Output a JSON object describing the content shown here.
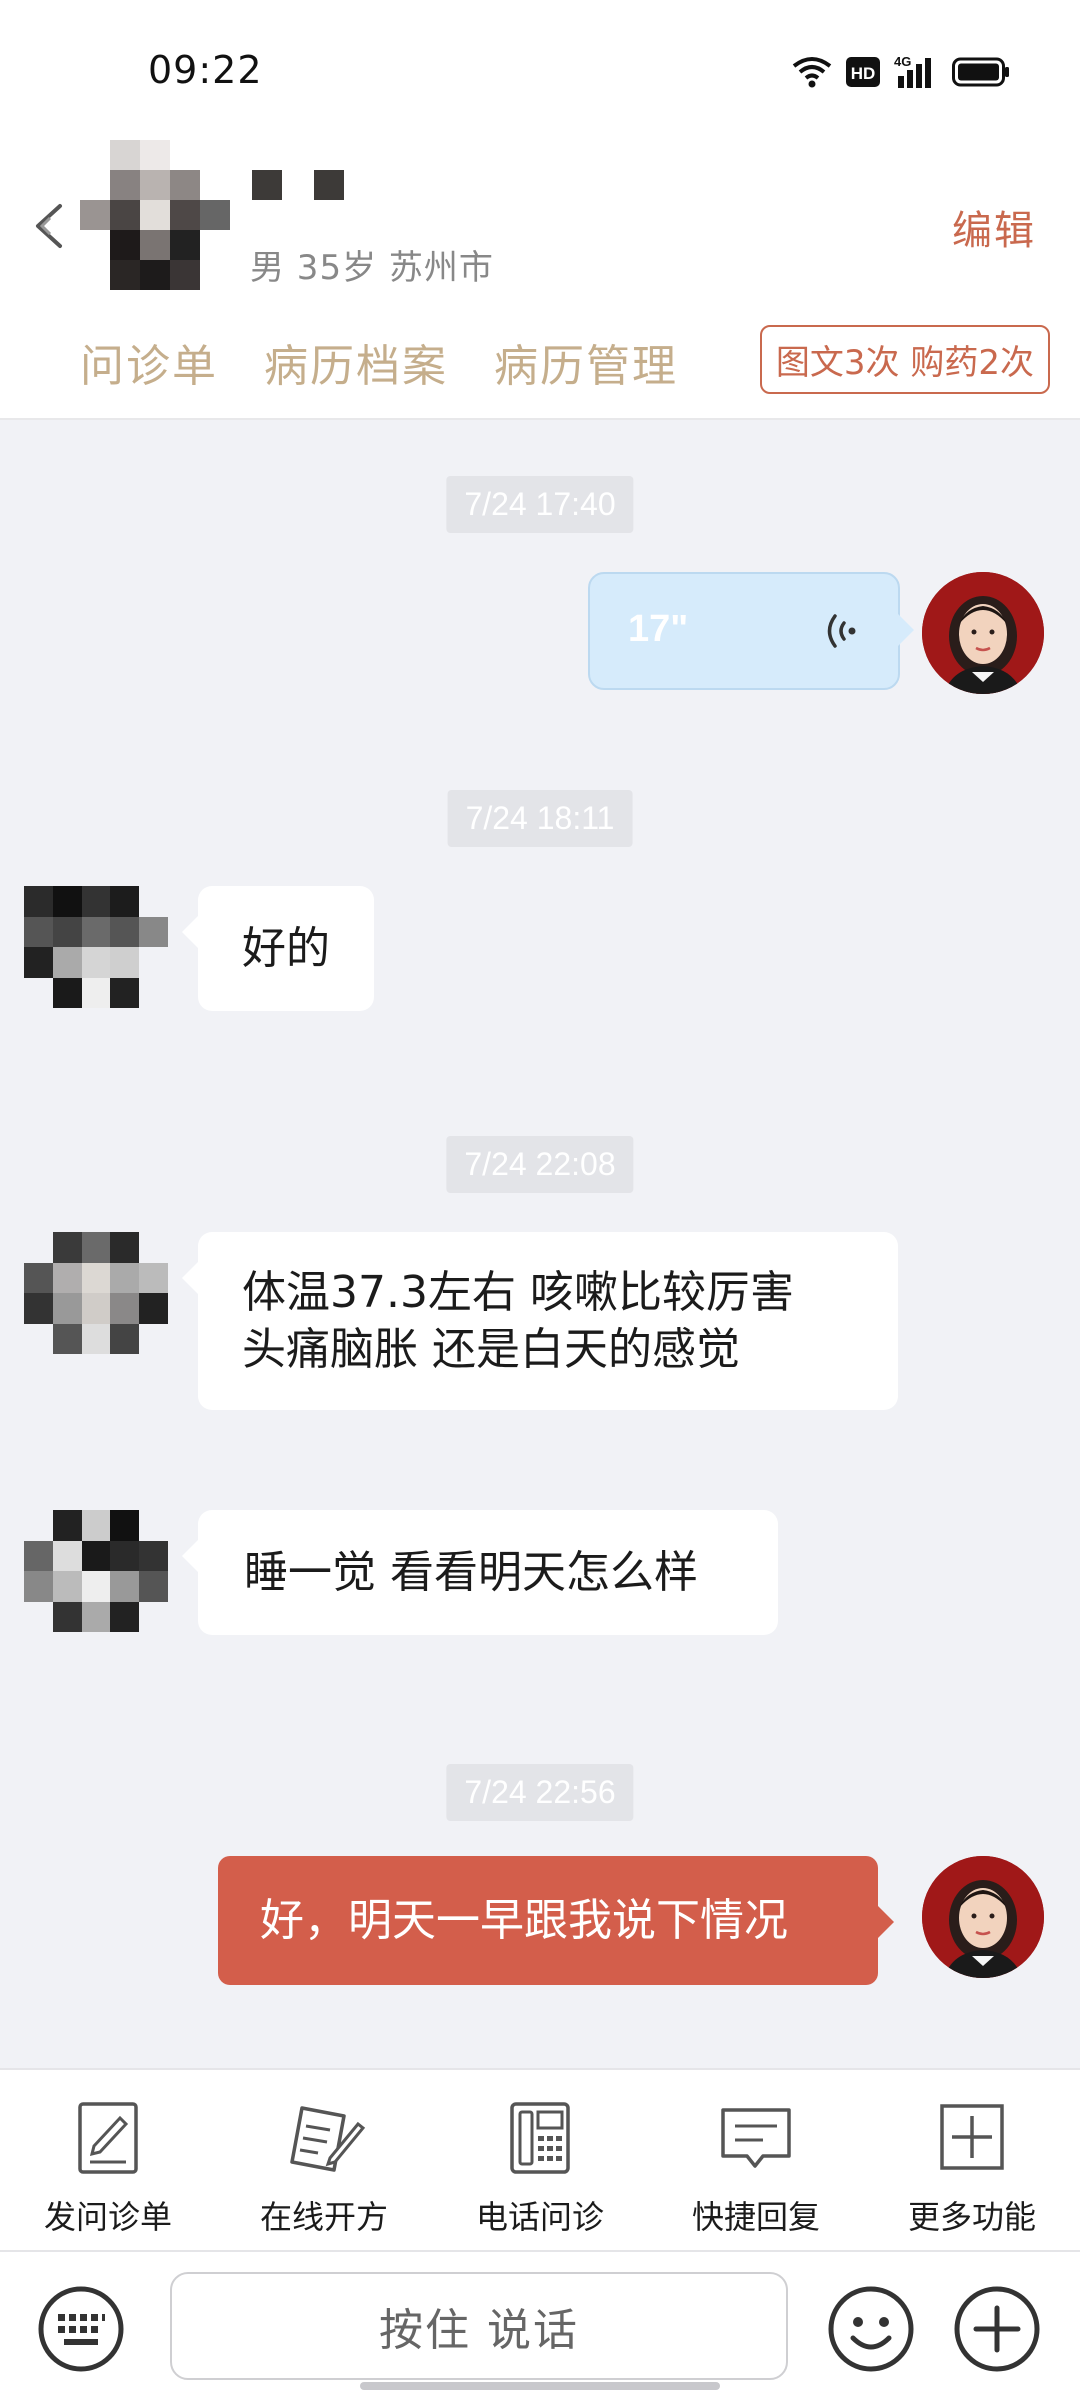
{
  "status_bar": {
    "time": "09:22",
    "icons": [
      "wifi-icon",
      "hd-icon",
      "4g-signal-icon",
      "battery-icon"
    ],
    "hd_label": "HD",
    "network_label": "4G"
  },
  "header": {
    "patient_info": "男 35岁  苏州市",
    "edit_label": "编辑",
    "tabs": [
      {
        "label": "问诊单"
      },
      {
        "label": "病历档案"
      },
      {
        "label": "病历管理"
      }
    ],
    "badge": "图文3次 购药2次"
  },
  "chat": {
    "messages": [
      {
        "timestamp": "7/24 17:40",
        "sender": "doctor",
        "type": "voice",
        "duration": "17\""
      },
      {
        "timestamp": "7/24 18:11",
        "sender": "patient",
        "type": "text",
        "text": "好的"
      },
      {
        "timestamp": "7/24 22:08",
        "sender": "patient",
        "type": "text",
        "lines": [
          "体温37.3左右  咳嗽比较厉害",
          "头痛脑胀 还是白天的感觉"
        ]
      },
      {
        "sender": "patient",
        "type": "text",
        "text": "睡一觉 看看明天怎么样"
      },
      {
        "timestamp": "7/24 22:56",
        "sender": "doctor",
        "type": "text",
        "text": "好，明天一早跟我说下情况"
      }
    ]
  },
  "toolbar": {
    "items": [
      {
        "label": "发问诊单",
        "icon": "form-icon"
      },
      {
        "label": "在线开方",
        "icon": "prescription-icon"
      },
      {
        "label": "电话问诊",
        "icon": "phone-icon"
      },
      {
        "label": "快捷回复",
        "icon": "quick-reply-icon"
      },
      {
        "label": "更多功能",
        "icon": "plus-square-icon"
      }
    ]
  },
  "input_bar": {
    "voice_label": "按住 说话"
  },
  "colors": {
    "accent": "#d35e4b",
    "tab_text": "#c5ae8c",
    "voice_bubble": "#d6ebfb",
    "background": "#f1f2f6"
  }
}
